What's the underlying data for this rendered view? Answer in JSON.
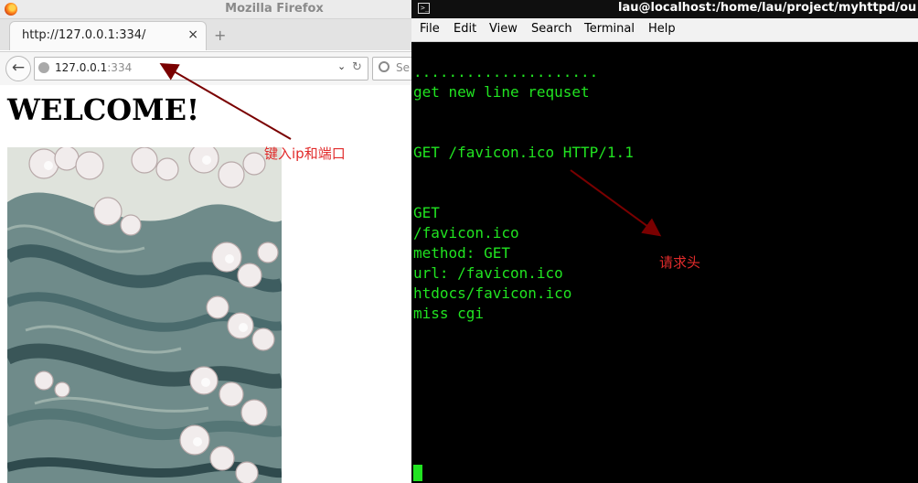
{
  "firefox": {
    "window_title": "Mozilla Firefox",
    "tab": {
      "title": "http://127.0.0.1:334/",
      "close": "×"
    },
    "new_tab": "+",
    "nav": {
      "back": "←",
      "url_host": "127.0.0.1",
      "url_port": ":334",
      "dropdown": "⌄",
      "reload": "↻",
      "search_placeholder": "Se"
    },
    "page": {
      "heading": "WELCOME!"
    }
  },
  "terminal": {
    "title": "lau@localhost:/home/lau/project/myhttpd/ou",
    "menu": [
      "File",
      "Edit",
      "View",
      "Search",
      "Terminal",
      "Help"
    ],
    "lines": [
      ".....................",
      "get new line requset",
      "",
      "",
      "GET /favicon.ico HTTP/1.1",
      "",
      "",
      "GET",
      "/favicon.ico",
      "method: GET",
      "url: /favicon.ico",
      "htdocs/favicon.ico",
      "miss cgi"
    ],
    "text_color": "#21e321"
  },
  "annotations": {
    "url_note": "键入ip和端口",
    "header_note": "请求头",
    "color": "#e12b2b",
    "arrow_color": "#7a0000"
  }
}
